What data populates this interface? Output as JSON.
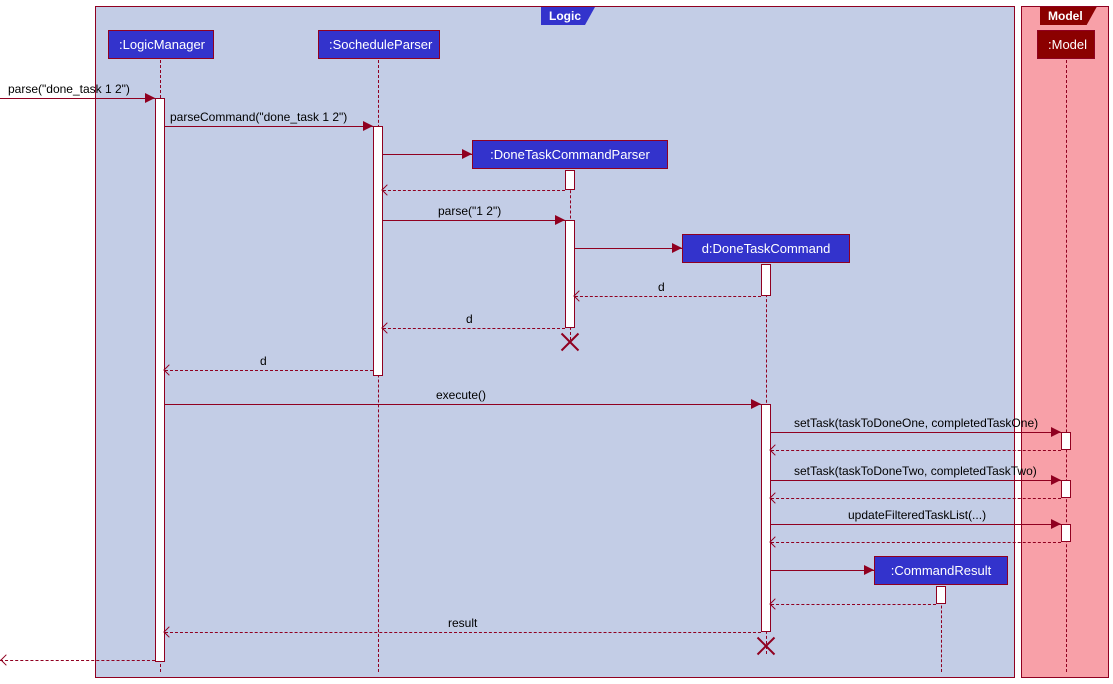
{
  "frames": {
    "logic": {
      "label": "Logic"
    },
    "model": {
      "label": "Model"
    }
  },
  "participants": {
    "logicManager": ":LogicManager",
    "socheduleParser": ":SocheduleParser",
    "doneTaskCommandParser": ":DoneTaskCommandParser",
    "doneTaskCommand": "d:DoneTaskCommand",
    "commandResult": ":CommandResult",
    "model": ":Model"
  },
  "messages": {
    "m1": "parse(\"done_task 1 2\")",
    "m2": "parseCommand(\"done_task 1 2\")",
    "m3": "parse(\"1 2\")",
    "m4": "d",
    "m5": "d",
    "m6": "d",
    "m7": "execute()",
    "m8": "setTask(taskToDoneOne, completedTaskOne)",
    "m9": "setTask(taskToDoneTwo, completedTaskTwo)",
    "m10": "updateFilteredTaskList(...)",
    "m11": "result"
  }
}
